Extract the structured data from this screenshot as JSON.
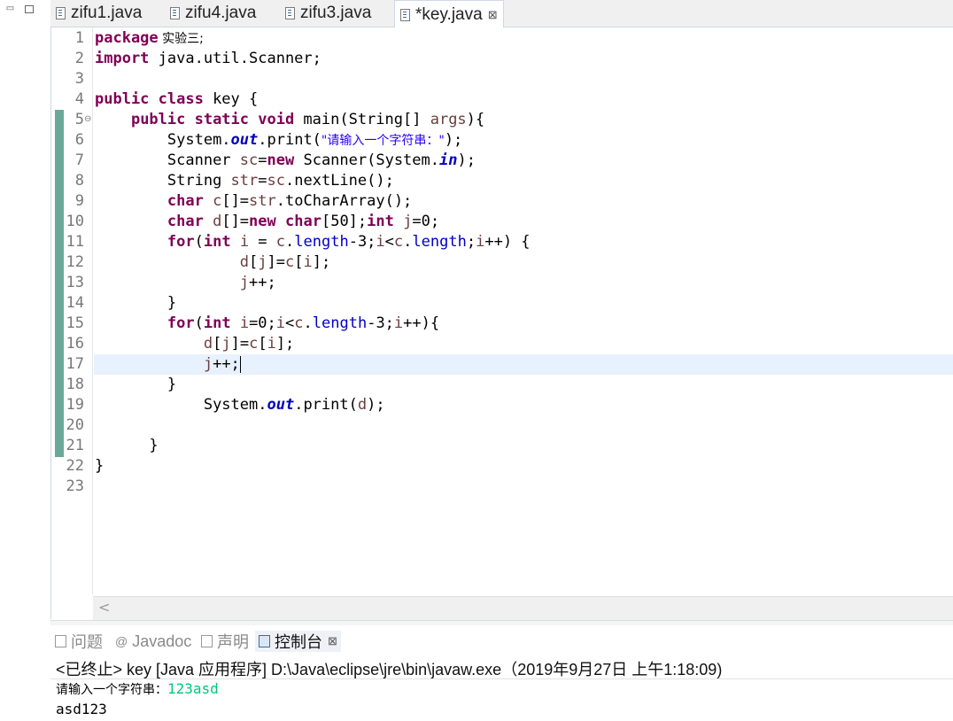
{
  "window": {
    "min_label": "▭",
    "max_label": ""
  },
  "tabs": [
    {
      "label": "zifu1.java"
    },
    {
      "label": "zifu4.java"
    },
    {
      "label": "zifu3.java"
    },
    {
      "label": "*key.java",
      "close": "⊠"
    }
  ],
  "editor": {
    "line_numbers": [
      "1",
      "2",
      "3",
      "4",
      "5",
      "6",
      "7",
      "8",
      "9",
      "10",
      "11",
      "12",
      "13",
      "14",
      "15",
      "16",
      "17",
      "18",
      "19",
      "20",
      "21",
      "22",
      "23"
    ],
    "fold_marker": "⊖",
    "code": {
      "l1_kw": "package",
      "l1_rest": " 实验三;",
      "l2_kw": "import",
      "l2_rest": " java.util.Scanner;",
      "l4_kw": "public class",
      "l4_rest": " key {",
      "l5_kw": "public static void",
      "l5_rest": " main(String[] ",
      "l5_var": "args",
      "l5_end": "){",
      "l6_a": "System.",
      "l6_fld": "out",
      "l6_b": ".print(",
      "l6_str": "\"请输入一个字符串：\"",
      "l6_end": ");",
      "l7_a": "Scanner ",
      "l7_var": "sc",
      "l7_b": "=",
      "l7_kw": "new",
      "l7_c": " Scanner(System.",
      "l7_fld": "in",
      "l7_end": ");",
      "l8_a": "String ",
      "l8_var": "str",
      "l8_b": "=",
      "l8_var2": "sc",
      "l8_end": ".nextLine();",
      "l9_kw": "char",
      "l9_var": " c",
      "l9_b": "[]=",
      "l9_var2": "str",
      "l9_end": ".toCharArray();",
      "l10_kw": "char",
      "l10_var": " d",
      "l10_b": "[]=",
      "l10_kw2": "new",
      "l10_c": " ",
      "l10_kw3": "char",
      "l10_d": "[50];",
      "l10_kw4": "int",
      "l10_var2": " j",
      "l10_end": "=0;",
      "l11_kw": "for",
      "l11_a": "(",
      "l11_kw2": "int",
      "l11_var": " i",
      "l11_b": " = ",
      "l11_var2": "c",
      "l11_c": ".",
      "l11_prop": "length",
      "l11_d": "-3;",
      "l11_var3": "i",
      "l11_e": "<",
      "l11_var4": "c",
      "l11_f": ".",
      "l11_prop2": "length",
      "l11_g": ";",
      "l11_var5": "i",
      "l11_end": "++) {",
      "l12_var": "d",
      "l12_a": "[",
      "l12_var2": "j",
      "l12_b": "]=",
      "l12_var3": "c",
      "l12_c": "[",
      "l12_var4": "i",
      "l12_end": "];",
      "l13_var": "j",
      "l13_end": "++;",
      "l14": "}",
      "l15_kw": "for",
      "l15_a": "(",
      "l15_kw2": "int",
      "l15_var": " i",
      "l15_b": "=0;",
      "l15_var2": "i",
      "l15_c": "<",
      "l15_var3": "c",
      "l15_d": ".",
      "l15_prop": "length",
      "l15_e": "-3;",
      "l15_var4": "i",
      "l15_end": "++){",
      "l16_var": "d",
      "l16_a": "[",
      "l16_var2": "j",
      "l16_b": "]=",
      "l16_var3": "c",
      "l16_c": "[",
      "l16_var4": "i",
      "l16_end": "];",
      "l17_var": "j",
      "l17_end": "++;",
      "l18": "}",
      "l19_a": "System.",
      "l19_fld": "out",
      "l19_b": ".print(",
      "l19_var": "d",
      "l19_end": ");",
      "l21": "}",
      "l22": "}"
    },
    "scroll_left": "<"
  },
  "panel": {
    "tabs": [
      {
        "label": "问题"
      },
      {
        "label": "Javadoc"
      },
      {
        "label": "声明"
      },
      {
        "label": "控制台",
        "close": "⊠"
      }
    ],
    "console_header": "<已终止> key [Java 应用程序] D:\\Java\\eclipse\\jre\\bin\\javaw.exe（2019年9月27日 上午1:18:09)",
    "prompt": "请输入一个字符串：",
    "input": "123asd",
    "output": "asd123"
  },
  "colors": {
    "keyword": "#7f0055",
    "string": "#2a00ff",
    "field": "#0000c0",
    "variable": "#6a3e3e",
    "console_input": "#00c87d",
    "current_line": "#e8f2fe",
    "change_ruler": "#6aa99a"
  },
  "icons": {
    "file": "java-file-icon",
    "problems": "problems-icon",
    "javadoc": "at-icon",
    "declaration": "declaration-icon",
    "console": "console-icon"
  }
}
